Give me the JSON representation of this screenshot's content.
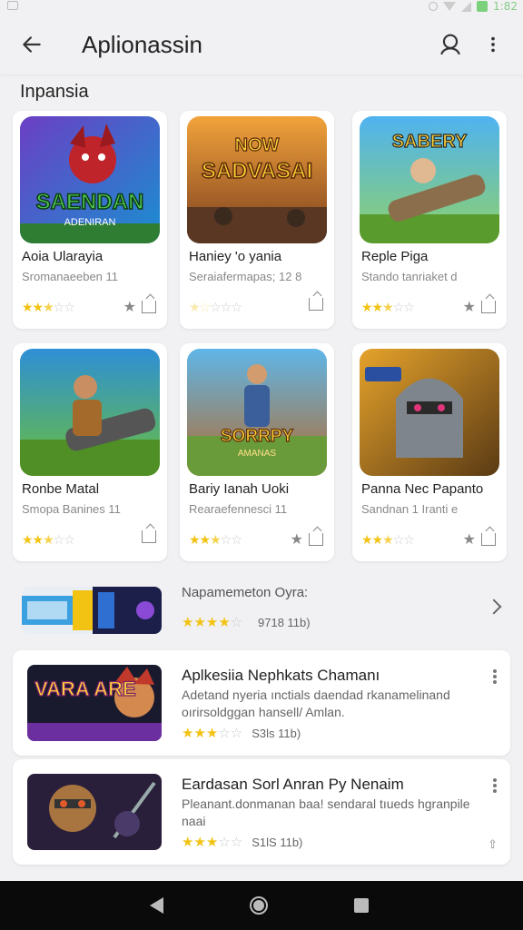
{
  "status": {
    "time": "1:82"
  },
  "appbar": {
    "title": "Aplionassin"
  },
  "section": {
    "title": "Inpansia"
  },
  "grid": [
    {
      "name": "Aoia Ularayia",
      "dev": "Sromanaeeben 11",
      "rating": 2.5,
      "thumb_text": "SAENDAN",
      "thumb_sub": "ADENIRAN"
    },
    {
      "name": "Haniey 'o yania",
      "dev": "Seraiafermapas; 12 8",
      "rating": 1.5,
      "thumb_text": "SADVASAI",
      "thumb_sub": "NOW"
    },
    {
      "name": "Reple Piga",
      "dev": "Stando tanriaket d",
      "rating": 2.5,
      "thumb_text": "SABERY",
      "thumb_sub": ""
    },
    {
      "name": "Ronbe Matal",
      "dev": "Smopa Banines 11",
      "rating": 2.5,
      "thumb_text": "",
      "thumb_sub": ""
    },
    {
      "name": "Bariy Ianah Uoki",
      "dev": "Rearaefennesci 11",
      "rating": 2.5,
      "thumb_text": "SORRPY",
      "thumb_sub": "AMANAS"
    },
    {
      "name": "Panna Nec Papanto",
      "dev": "Sandnan 1 Iranti e",
      "rating": 2.5,
      "thumb_text": "",
      "thumb_sub": ""
    }
  ],
  "featured": {
    "title": "Napamemeton Oyra:",
    "rating": 4,
    "count": "9718 11b)"
  },
  "list": [
    {
      "title": "Aplkesiia Nephkats Chamanı",
      "desc": "Adetand nyeria ınctials daendad rkanamelinand oırirsoldggan hansell/ Amlan.",
      "rating": 3,
      "count": "S3ls 11b)",
      "thumb_text": "VARA ARE"
    },
    {
      "title": "Eardasan Sorl Anran Py Nenaim",
      "desc": "Pleanant.donmanan baa! sendaral tıueds hgranpile naai",
      "rating": 3,
      "count": "S1lS 11b)",
      "thumb_text": ""
    }
  ],
  "icons": {
    "back": "arrow-left-icon",
    "search": "search-icon",
    "more": "more-vert-icon",
    "share": "share-icon",
    "favorite": "star-icon"
  },
  "colors": {
    "star": "#f2c313",
    "accent": "#222222"
  }
}
